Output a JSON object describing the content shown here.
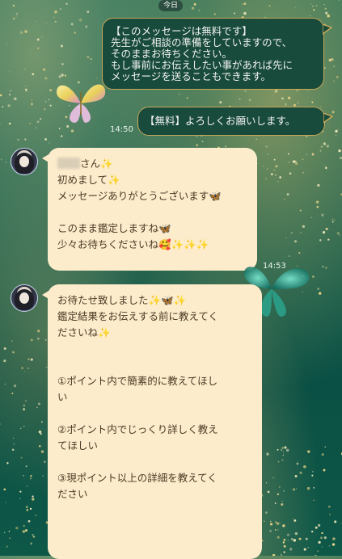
{
  "date_label": "今日",
  "messages": [
    {
      "side": "out",
      "text": "【このメッセージは無料です】\n先生がご相談の準備をしていますので、\nそのままお待ちください。\nもし事前にお伝えしたい事があれば先に\nメッセージを送ることもできます。"
    },
    {
      "side": "out",
      "text": "【無料】よろしくお願いします。",
      "time": "14:50"
    },
    {
      "side": "in",
      "name_suffix": "さん",
      "lines": [
        "初めまして",
        "メッセージありがとうございます",
        "",
        "このまま鑑定しますね",
        "少々お待ちくださいね"
      ],
      "time": "14:53"
    },
    {
      "side": "in",
      "lines": [
        "お待たせ致しました",
        "鑑定結果をお伝えする前に教えてく",
        "ださいね",
        "",
        "",
        "①ポイント内で簡素的に教えてほし",
        "い",
        "",
        "②ポイント内でじっくり詳しく教え",
        "てほしい",
        "",
        "③現ポイント以上の詳細を教えてく",
        "ださい"
      ]
    }
  ],
  "icons": {
    "sparkle": "✨",
    "butterfly": "🦋",
    "smiling_face_hearts": "🥰"
  }
}
